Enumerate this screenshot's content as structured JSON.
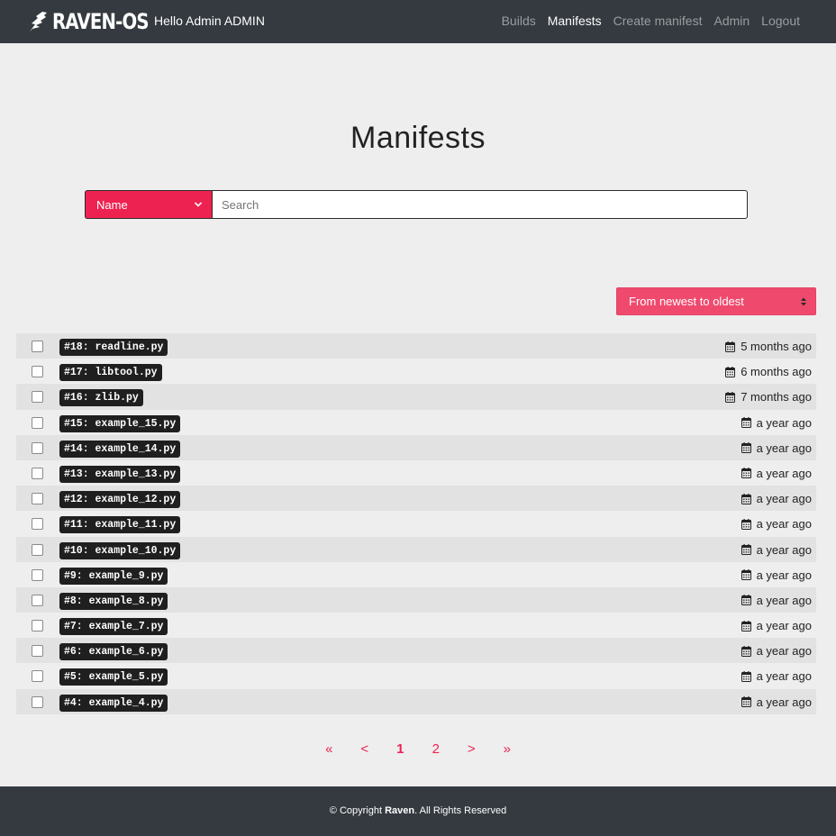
{
  "nav": {
    "brand": "RAVEN-OS",
    "greeting": "Hello Admin ADMIN",
    "links": [
      {
        "label": "Builds",
        "active": false
      },
      {
        "label": "Manifests",
        "active": true
      },
      {
        "label": "Create manifest",
        "active": false
      },
      {
        "label": "Admin",
        "active": false
      },
      {
        "label": "Logout",
        "active": false
      }
    ]
  },
  "page": {
    "title": "Manifests"
  },
  "search": {
    "field": "Name",
    "placeholder": "Search",
    "value": ""
  },
  "sort": {
    "selected": "From newest to oldest"
  },
  "manifests": [
    {
      "label": "#18: readline.py",
      "date": "5 months ago"
    },
    {
      "label": "#17: libtool.py",
      "date": "6 months ago"
    },
    {
      "label": "#16: zlib.py",
      "date": "7 months ago"
    },
    {
      "label": "#15: example_15.py",
      "date": "a year ago"
    },
    {
      "label": "#14: example_14.py",
      "date": "a year ago"
    },
    {
      "label": "#13: example_13.py",
      "date": "a year ago"
    },
    {
      "label": "#12: example_12.py",
      "date": "a year ago"
    },
    {
      "label": "#11: example_11.py",
      "date": "a year ago"
    },
    {
      "label": "#10: example_10.py",
      "date": "a year ago"
    },
    {
      "label": "#9: example_9.py",
      "date": "a year ago"
    },
    {
      "label": "#8: example_8.py",
      "date": "a year ago"
    },
    {
      "label": "#7: example_7.py",
      "date": "a year ago"
    },
    {
      "label": "#6: example_6.py",
      "date": "a year ago"
    },
    {
      "label": "#5: example_5.py",
      "date": "a year ago"
    },
    {
      "label": "#4: example_4.py",
      "date": "a year ago"
    }
  ],
  "pagination": {
    "first": "«",
    "prev": "<",
    "pages": [
      "1",
      "2"
    ],
    "current": "1",
    "next": ">",
    "last": "»"
  },
  "footer": {
    "prefix": "© Copyright ",
    "brand": "Raven",
    "suffix": ". All Rights Reserved"
  },
  "colors": {
    "accent": "#ee2250",
    "navbar": "#343a40",
    "background": "#eeeeee"
  },
  "icons": {
    "date": "calendar-icon",
    "checkbox": "checkbox-icon",
    "logo": "raven-logo-icon"
  }
}
